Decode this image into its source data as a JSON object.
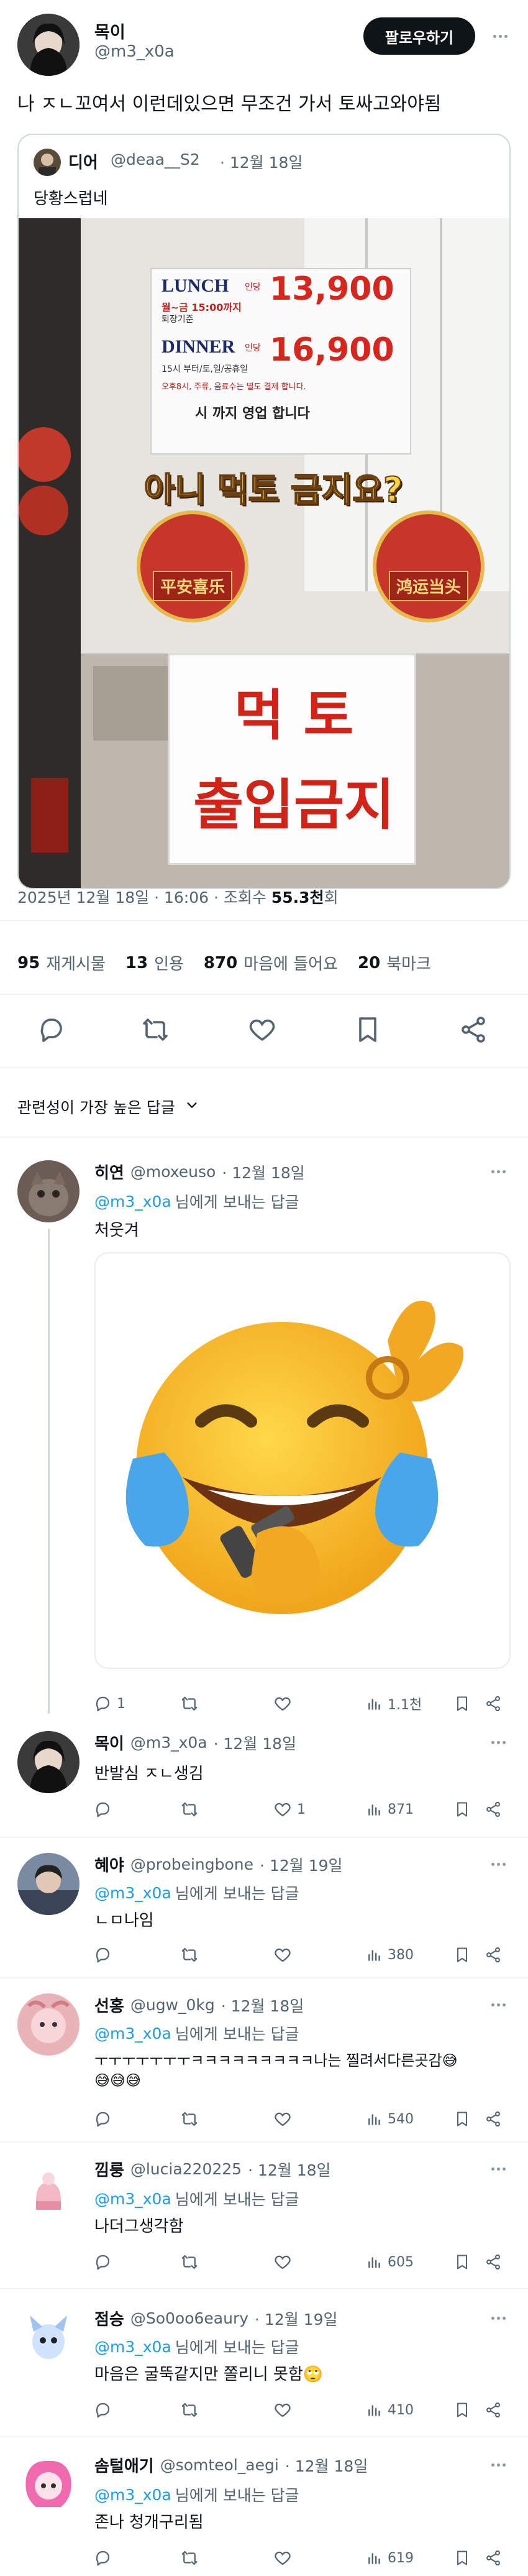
{
  "tweet": {
    "author_name": "목이",
    "author_handle": "@m3_x0a",
    "follow_label": "팔로우하기",
    "text": "나 ㅈㄴ꼬여서 이런데있으면 무조건 가서 토싸고와야됨",
    "quote": {
      "author_name": "디어",
      "author_handle": "@deaa__S2",
      "date": "· 12월 18일",
      "text": "당황스럽네",
      "sign": {
        "lunch": "LUNCH",
        "lunch_note": "월~금 15:00까지",
        "lunch_note2": "퇴장기준",
        "lunch_price_label": "인당",
        "lunch_price": "13,900",
        "dinner": "DINNER",
        "dinner_price_label": "인당",
        "dinner_price": "16,900",
        "dinner_note": "15시 부터/토,일/공휴일",
        "holiday_note": "오후8시, 주류, 음료수는 별도 결제 합니다.",
        "hours": "시 까지 영업 합니다",
        "overlay": "아니 먹토 금지요?",
        "banner_left": "平安喜乐",
        "banner_right": "鸿运当头",
        "big_line1": "먹 토",
        "big_line2": "출입금지"
      }
    },
    "meta": {
      "time": "2025년 12월 18일 · 16:06 · 조회수",
      "views": "55.3천",
      "views_suffix": "회"
    },
    "stats": {
      "retweets": "95",
      "retweets_label": "재게시물",
      "quotes": "13",
      "quotes_label": "인용",
      "likes": "870",
      "likes_label": "마음에 들어요",
      "bookmarks": "20",
      "bookmarks_label": "북마크"
    }
  },
  "sort_label": "관련성이 가장 높은 답글",
  "replying_suffix": "님에게 보내는 답글",
  "replies": [
    {
      "name": "히연",
      "handle": "@moxeuso",
      "date": "· 12월 18일",
      "reply_to": "@m3_x0a",
      "text": "처웃겨",
      "replies": "1",
      "retweets": "",
      "likes": "",
      "views": "1.1천"
    },
    {
      "name": "목이",
      "handle": "@m3_x0a",
      "date": "· 12월 18일",
      "reply_to": "",
      "text": "반발심 ㅈㄴ생김",
      "replies": "",
      "retweets": "",
      "likes": "1",
      "views": "871"
    },
    {
      "name": "혜야",
      "handle": "@probeingbone",
      "date": "· 12월 19일",
      "reply_to": "@m3_x0a",
      "text": "ㄴㅁ나임",
      "replies": "",
      "retweets": "",
      "likes": "",
      "views": "380"
    },
    {
      "name": "선홍",
      "handle": "@ugw_0kg",
      "date": "· 12월 18일",
      "reply_to": "@m3_x0a",
      "text": "ㅜㅜㅜㅜㅜㅜㅜㅋㅋㅋㅋㅋㅋㅋㅋㅋ나는 찔려서다른곳감😅",
      "text2": "😅😅😅",
      "replies": "",
      "retweets": "",
      "likes": "",
      "views": "540"
    },
    {
      "name": "낌룽",
      "handle": "@lucia220225",
      "date": "· 12월 18일",
      "reply_to": "@m3_x0a",
      "text": "나더그생각함",
      "replies": "",
      "retweets": "",
      "likes": "",
      "views": "605"
    },
    {
      "name": "점승",
      "handle": "@So0oo6eaury",
      "date": "· 12월 19일",
      "reply_to": "@m3_x0a",
      "text": "마음은 굴뚝같지만 쫄리니 못함🙄",
      "replies": "",
      "retweets": "",
      "likes": "",
      "views": "410"
    },
    {
      "name": "솜털애기",
      "handle": "@somteol_aegi",
      "date": "· 12월 18일",
      "reply_to": "@m3_x0a",
      "text": "존나 청개구리됨",
      "replies": "",
      "retweets": "",
      "likes": "",
      "views": "619"
    }
  ],
  "icons": {
    "reply": "reply-icon",
    "retweet": "retweet-icon",
    "like": "heart-icon",
    "bookmark": "bookmark-icon",
    "share": "share-icon",
    "views": "views-icon",
    "more": "more-dots-icon",
    "chevron": "chevron-down-icon"
  },
  "colors": {
    "accent": "#1d9bf0",
    "text": "#0f1419",
    "muted": "#536471",
    "border": "#eff3f4"
  }
}
